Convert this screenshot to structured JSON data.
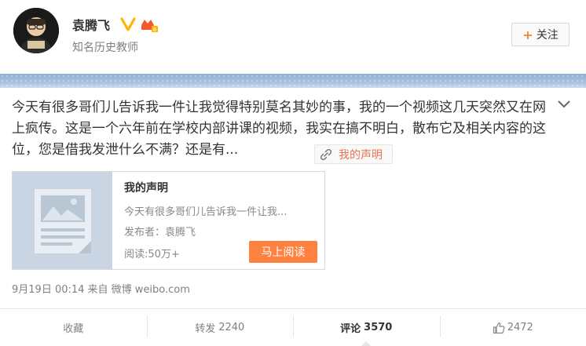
{
  "header": {
    "name": "袁腾飞",
    "subtitle": "知名历史教师",
    "follow_label": "关注"
  },
  "post": {
    "text": "今天有很多哥们儿告诉我一件让我觉得特别莫名其妙的事，我的一个视频这几天突然又在网上疯传。这是一个六年前在学校内部讲课的视频，我实在搞不明白，散布它及相关内容的这位，您是借我发泄什么不满？还是有...",
    "link_label": "我的声明",
    "card": {
      "title": "我的声明",
      "summary": "今天有很多哥们儿告诉我一件让我...",
      "publisher": "发布者：袁腾飞",
      "reads": "阅读:50万+",
      "read_button": "马上阅读"
    },
    "meta": "9月19日 00:14 来自 微博 weibo.com"
  },
  "actions": {
    "favorite": "收藏",
    "repost_label": "转发",
    "repost_count": "2240",
    "comment_label": "评论",
    "comment_count": "3570",
    "like_count": "2472"
  },
  "colors": {
    "accent": "#ff8140",
    "link": "#eb7350",
    "verified": "#ffb500"
  },
  "icons": [
    "verified-badge-icon",
    "vip-icon",
    "plus-icon",
    "chevron-down-icon",
    "link-clip-icon",
    "document-thumbnail-icon",
    "thumb-up-icon"
  ]
}
